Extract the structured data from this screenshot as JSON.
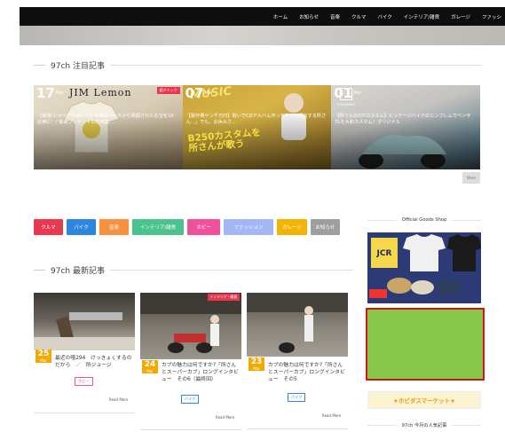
{
  "nav": {
    "items": [
      "ホーム",
      "お知らせ",
      "音楽",
      "クルマ",
      "バイク",
      "インテリア/雑貨",
      "ガレージ",
      "ファッシ"
    ]
  },
  "featured": {
    "heading": "97ch 注目記事",
    "more_label": "More",
    "slides": [
      {
        "day": "17",
        "month": "Mar",
        "year": "2020",
        "logo_text": "JIM Lemon",
        "caption": "【抽選!シャツプレゼント】世田谷ベースから発掘されたお宝を10名様に！/ 抽選プレゼントの告知案...",
        "tag": "超デミック"
      },
      {
        "day": "07",
        "month": "Mar",
        "year": "2020",
        "overlay_text": "MUSIC",
        "big_text": "B250カスタムを\n所さんが歌う",
        "caption": "【製作費ゲン千万円】勢いでCDアルバム作っちゃって反省する所さん...」でも、お休みさ..."
      },
      {
        "day": "01",
        "month": "Mar",
        "year": "2020",
        "channel_text": "97CHANNEL",
        "caption": "【所さんのDIYカスタム】ビンテージバイクのエンブレムでベンザ5Lを大和カスタム！オリジナル"
      }
    ]
  },
  "categories": [
    {
      "label": "クルマ",
      "color": "#e8384f"
    },
    {
      "label": "バイク",
      "color": "#2f86e0"
    },
    {
      "label": "音楽",
      "color": "#f7913d"
    },
    {
      "label": "インテリア/雑貨",
      "color": "#4cc28f"
    },
    {
      "label": "ホビー",
      "color": "#f0519b"
    },
    {
      "label": "ファッション",
      "color": "#a6b6f5"
    },
    {
      "label": "ガレージ",
      "color": "#f2b400"
    },
    {
      "label": "お知らせ",
      "color": "#9e9e9e"
    }
  ],
  "latest": {
    "heading": "97ch 最新記事",
    "posts": [
      {
        "day": "25",
        "month": "Mar",
        "title": "最近の嘻294　けっきょくするのだから　／　所ジョージ",
        "tag": "ホビー",
        "tag_color": "#f0519b",
        "read_more": "Read More"
      },
      {
        "day": "24",
        "month": "Mar",
        "title": "カブの魅力は何ですか?「所さんとスーパーカブ」ロングインタビュー　その6（最終回）",
        "tag": "バイク",
        "tag_color": "#2f86e0",
        "read_more": "Read More",
        "corner_tag": "インテリア・雑貨"
      },
      {
        "day": "23",
        "month": "Mar",
        "title": "カブの魅力は何ですか?「所さんとスーパーカブ」ロングインタビュー　その5",
        "tag": "バイク",
        "tag_color": "#2f86e0",
        "read_more": "Read More"
      }
    ]
  },
  "sidebar": {
    "goods_title": "Official Goods Shop",
    "goods_image_text": "JCR",
    "market_label": "★ホビダスマーケット★",
    "popular_title": "97ch 今月の人気記事"
  }
}
